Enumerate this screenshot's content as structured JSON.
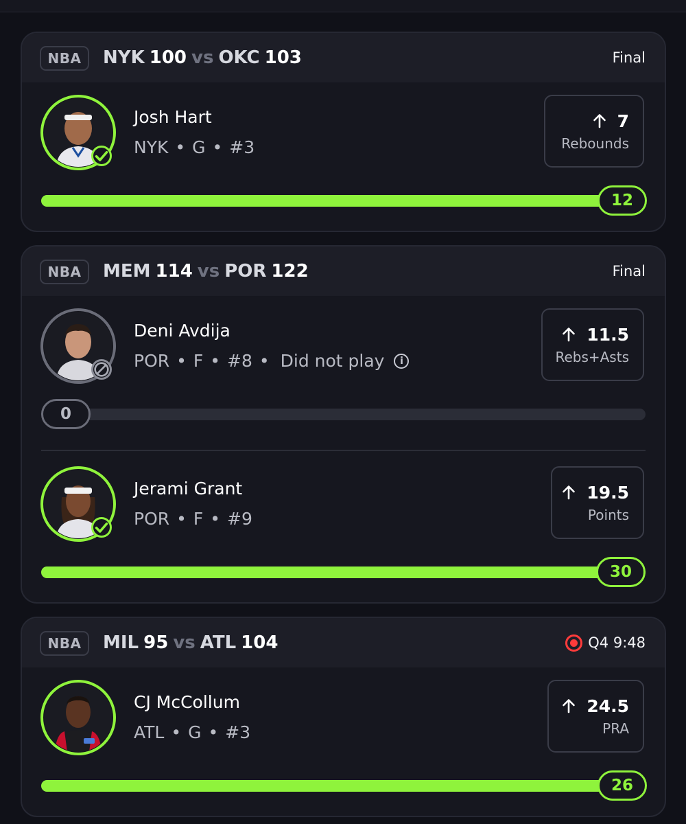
{
  "cards": [
    {
      "league": "NBA",
      "team1": "NYK",
      "score1": "100",
      "vs": "vs",
      "team2": "OKC",
      "score2": "103",
      "status": "Final",
      "players": [
        {
          "name": "Josh Hart",
          "team": "NYK",
          "position": "G",
          "number": "#3",
          "line": "7",
          "stat": "Rebounds",
          "actual": "12",
          "progress": 1.0,
          "result": "hit"
        }
      ]
    },
    {
      "league": "NBA",
      "team1": "MEM",
      "score1": "114",
      "vs": "vs",
      "team2": "POR",
      "score2": "122",
      "status": "Final",
      "players": [
        {
          "name": "Deni Avdija",
          "team": "POR",
          "position": "F",
          "number": "#8",
          "note": "Did not play",
          "line": "11.5",
          "stat": "Rebs+Asts",
          "actual": "0",
          "progress": 0.0,
          "result": "dnp"
        },
        {
          "name": "Jerami Grant",
          "team": "POR",
          "position": "F",
          "number": "#9",
          "line": "19.5",
          "stat": "Points",
          "actual": "30",
          "progress": 1.0,
          "result": "hit"
        }
      ]
    },
    {
      "league": "NBA",
      "team1": "MIL",
      "score1": "95",
      "vs": "vs",
      "team2": "ATL",
      "score2": "104",
      "status": "Q4 9:48",
      "live": true,
      "players": [
        {
          "name": "CJ McCollum",
          "team": "ATL",
          "position": "G",
          "number": "#3",
          "line": "24.5",
          "stat": "PRA",
          "actual": "26",
          "progress": 1.0,
          "result": "hit"
        }
      ]
    }
  ],
  "separator": "•",
  "icons": {
    "up_arrow": "arrow-up-icon",
    "check": "check-icon",
    "ban": "ban-icon",
    "info": "info-icon",
    "live": "live-indicator-icon"
  },
  "colors": {
    "accent_green": "#8ff33c",
    "live_red": "#ff3b3b",
    "background": "#101118",
    "card": "#16171f"
  }
}
